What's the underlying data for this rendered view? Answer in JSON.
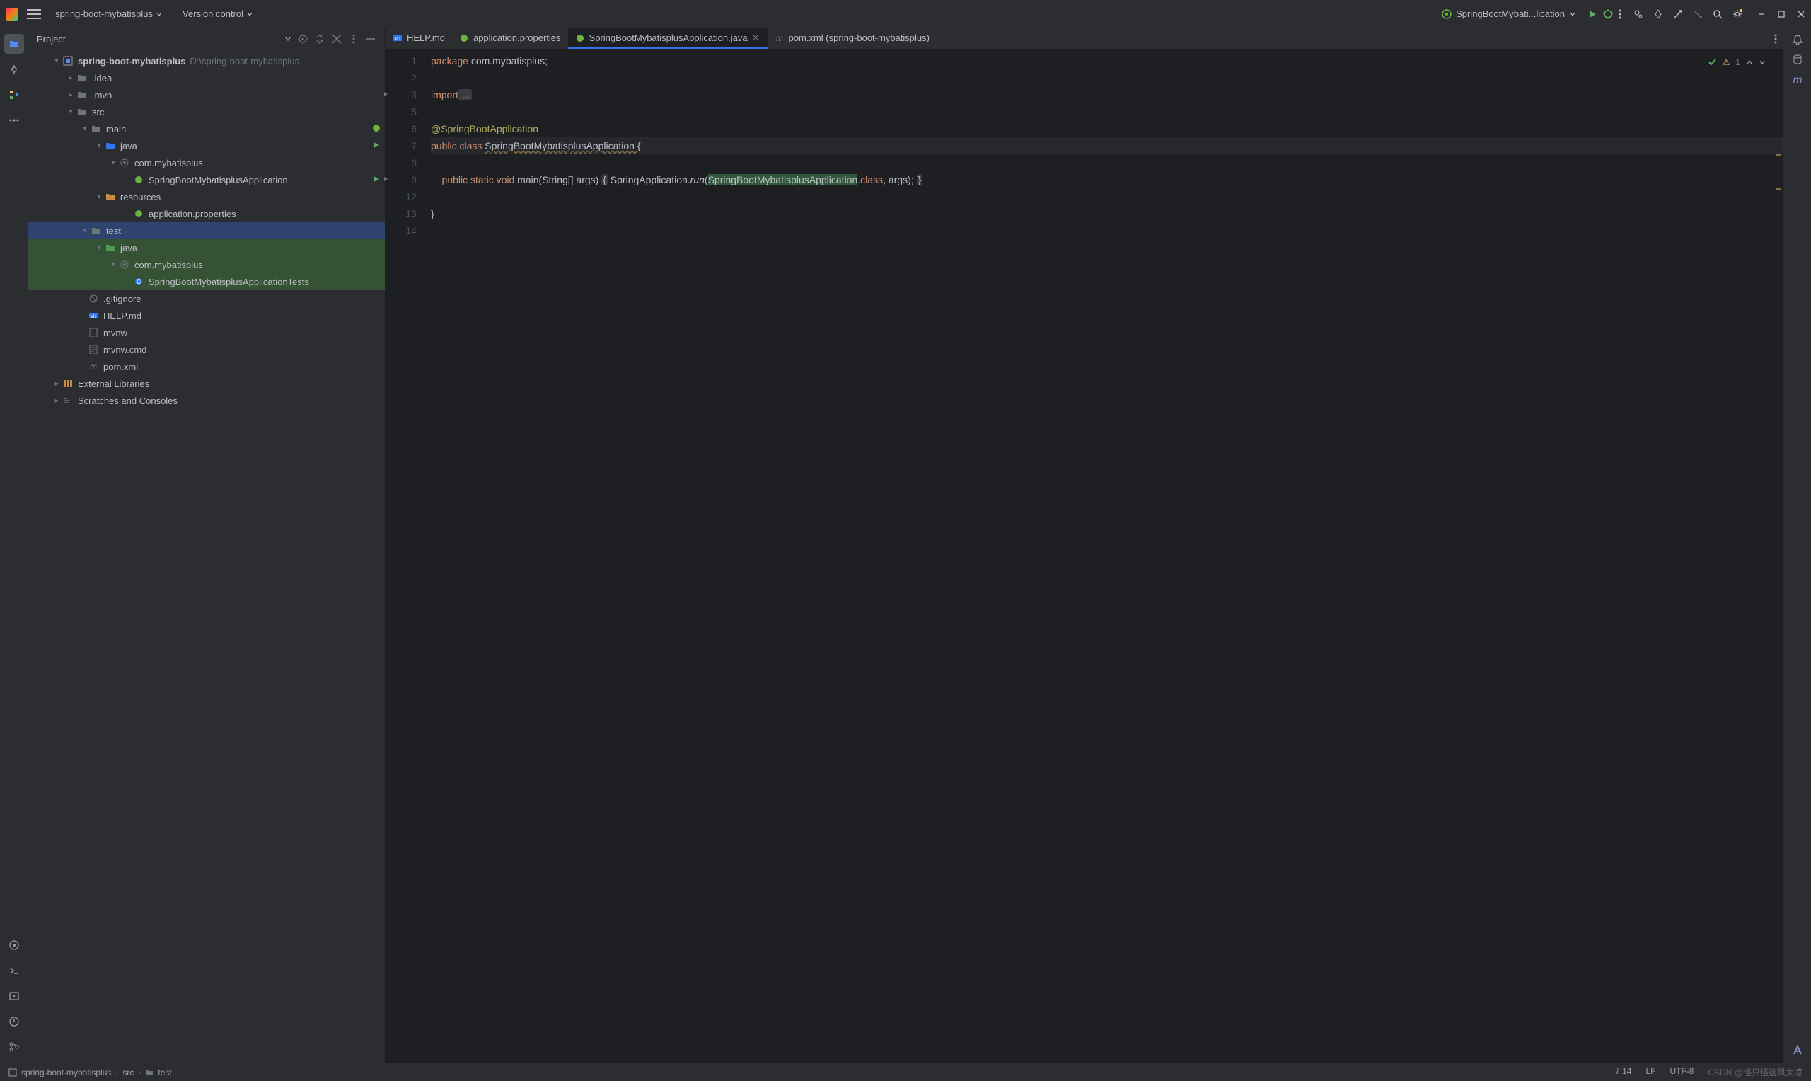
{
  "titlebar": {
    "project_name": "spring-boot-mybatisplus",
    "vcs_label": "Version control",
    "run_config": "SpringBootMybati...lication"
  },
  "panel": {
    "title": "Project"
  },
  "tree": {
    "root": "spring-boot-mybatisplus",
    "root_path": "D:\\spring-boot-mybatisplus",
    "idea": ".idea",
    "mvn": ".mvn",
    "src": "src",
    "main": "main",
    "java": "java",
    "pkg": "com.mybatisplus",
    "app_cls": "SpringBootMybatisplusApplication",
    "resources": "resources",
    "app_props": "application.properties",
    "test": "test",
    "test_java": "java",
    "test_pkg": "com.mybatisplus",
    "test_cls": "SpringBootMybatisplusApplicationTests",
    "gitignore": ".gitignore",
    "help": "HELP.md",
    "mvnw": "mvnw",
    "mvnw_cmd": "mvnw.cmd",
    "pom": "pom.xml",
    "ext_lib": "External Libraries",
    "scratches": "Scratches and Consoles"
  },
  "tabs": {
    "t1": "HELP.md",
    "t2": "application.properties",
    "t3": "SpringBootMybatisplusApplication.java",
    "t4": "pom.xml (spring-boot-mybatisplus)"
  },
  "editor": {
    "problems_count": "1"
  },
  "code": {
    "l1_1": "package",
    "l1_2": " com.mybatisplus;",
    "l3_1": "import",
    "l3_2": " ...",
    "l6_1": "@SpringBootApplication",
    "l7_1": "public class ",
    "l7_2": "SpringBootMybatisplusApplication ",
    "l7_3": "{",
    "l9_1": "    public static void ",
    "l9_2": "main",
    "l9_3": "(String[] args) ",
    "l9_4": "{",
    "l9_5": " SpringApplication.",
    "l9_6": "run",
    "l9_7": "(",
    "l9_8": "SpringBootMybatisplusApplication",
    "l9_9": ".",
    "l9_10": "class",
    "l9_11": ", args); ",
    "l9_12": "}",
    "l13_1": "}"
  },
  "status": {
    "bc1": "spring-boot-mybatisplus",
    "bc2": "src",
    "bc3": "test",
    "pos": "7:14",
    "le": "LF",
    "enc": "UTF-8",
    "watermark": "CSDN @怪只怪这风太凉"
  }
}
